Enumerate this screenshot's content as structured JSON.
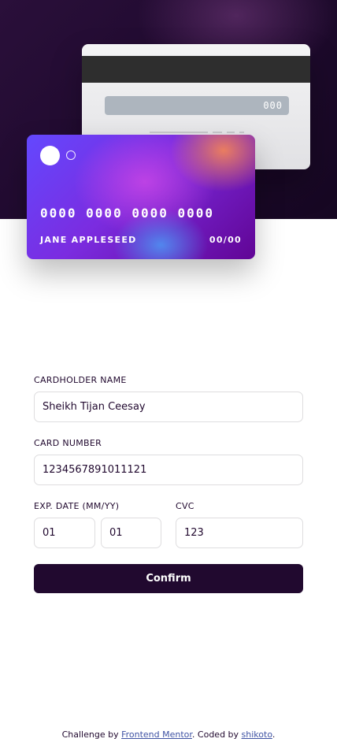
{
  "card_back": {
    "cvc": "000"
  },
  "card_front": {
    "number": "0000 0000 0000 0000",
    "holder": "JANE APPLESEED",
    "expiry": "00/00"
  },
  "form": {
    "cardholder_label": "CARDHOLDER NAME",
    "cardholder_value": "Sheikh Tijan Ceesay",
    "number_label": "CARD NUMBER",
    "number_value": "1234567891011121",
    "exp_label": "EXP. DATE (MM/YY)",
    "exp_month_value": "01",
    "exp_year_value": "01",
    "cvc_label": "CVC",
    "cvc_value": "123",
    "confirm_label": "Confirm"
  },
  "footer": {
    "prefix": "Challenge by ",
    "frontend_mentor_link": "Frontend Mentor",
    "middle": ". Coded by ",
    "author_link": "shikoto",
    "suffix": "."
  },
  "colors": {
    "dark_violet": "#21092f",
    "link": "#3e52a3",
    "border": "#dedddf"
  }
}
